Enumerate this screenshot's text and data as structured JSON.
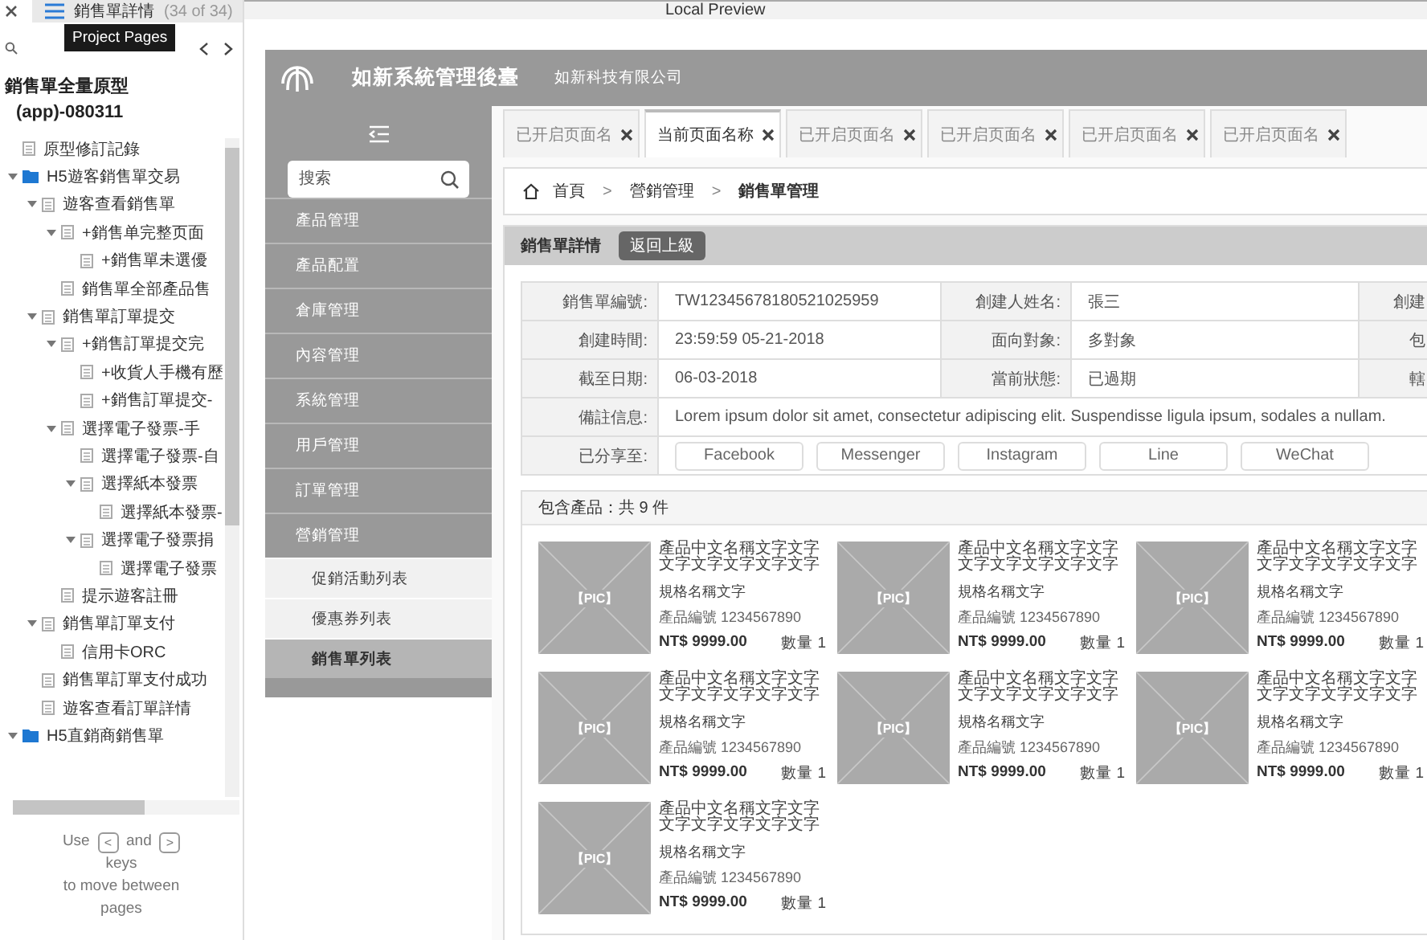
{
  "pages_panel": {
    "current_page": "銷售單詳情",
    "page_count": "(34 of 34)",
    "tooltip": "Project Pages",
    "project_title": "銷售單全量原型",
    "project_subtitle": "(app)-080311",
    "tree": [
      {
        "label": "原型修訂記錄",
        "kind": "page"
      },
      {
        "label": "H5遊客銷售單交易",
        "kind": "folder",
        "expanded": true,
        "children": [
          {
            "label": "遊客查看銷售單",
            "kind": "page",
            "expanded": true,
            "children": [
              {
                "label": "+銷售单完整页面",
                "kind": "page",
                "expanded": true,
                "children": [
                  {
                    "label": "+銷售單未選優",
                    "kind": "page"
                  }
                ]
              },
              {
                "label": "銷售單全部產品售",
                "kind": "page"
              }
            ]
          },
          {
            "label": "銷售單訂單提交",
            "kind": "page",
            "expanded": true,
            "children": [
              {
                "label": "+銷售訂單提交完",
                "kind": "page",
                "expanded": true,
                "children": [
                  {
                    "label": "+收貨人手機有歷",
                    "kind": "page"
                  },
                  {
                    "label": "+銷售訂單提交-",
                    "kind": "page"
                  }
                ]
              },
              {
                "label": "選擇電子發票-手",
                "kind": "page",
                "expanded": true,
                "children": [
                  {
                    "label": "選擇電子發票-自",
                    "kind": "page"
                  },
                  {
                    "label": "選擇紙本發票",
                    "kind": "page",
                    "expanded": true,
                    "children": [
                      {
                        "label": "選擇紙本發票-",
                        "kind": "page"
                      }
                    ]
                  },
                  {
                    "label": "選擇電子發票捐",
                    "kind": "page",
                    "expanded": true,
                    "children": [
                      {
                        "label": "選擇電子發票",
                        "kind": "page"
                      }
                    ]
                  }
                ]
              },
              {
                "label": "提示遊客註冊",
                "kind": "page"
              }
            ]
          },
          {
            "label": "銷售單訂單支付",
            "kind": "page",
            "expanded": true,
            "children": [
              {
                "label": "信用卡ORC",
                "kind": "page"
              }
            ]
          },
          {
            "label": "銷售單訂單支付成功",
            "kind": "page"
          },
          {
            "label": "遊客查看訂單詳情",
            "kind": "page"
          }
        ]
      },
      {
        "label": "H5直銷商銷售單",
        "kind": "folder",
        "expanded": true
      }
    ],
    "help": {
      "use": "Use",
      "prev_key": "<",
      "and": "and",
      "next_key": ">",
      "keys": "keys",
      "rest": "to move between pages"
    }
  },
  "preview": {
    "title": "Local Preview"
  },
  "app": {
    "title": "如新系統管理後臺",
    "company": "如新科技有限公司",
    "sidebar": {
      "search_placeholder": "搜索",
      "menu": [
        {
          "label": "產品管理"
        },
        {
          "label": "產品配置"
        },
        {
          "label": "倉庫管理"
        },
        {
          "label": "內容管理"
        },
        {
          "label": "系統管理"
        },
        {
          "label": "用戶管理"
        },
        {
          "label": "訂單管理"
        },
        {
          "label": "營銷管理",
          "children": [
            {
              "label": "促銷活動列表",
              "selected": false
            },
            {
              "label": "優惠券列表",
              "selected": false
            },
            {
              "label": "銷售單列表",
              "selected": true
            }
          ]
        }
      ]
    },
    "tabs": [
      {
        "label": "已开启页面名",
        "selected": false
      },
      {
        "label": "当前页面名称",
        "selected": true
      },
      {
        "label": "已开启页面名",
        "selected": false
      },
      {
        "label": "已开启页面名",
        "selected": false
      },
      {
        "label": "已开启页面名",
        "selected": false
      },
      {
        "label": "已开启页面名",
        "selected": false
      }
    ],
    "breadcrumb": {
      "separator": ">",
      "items": [
        "首頁",
        "營銷管理",
        "銷售單管理"
      ]
    },
    "detail": {
      "title": "銷售單詳情",
      "back_button": "返回上級",
      "rows": [
        {
          "cells": [
            "銷售單編號:",
            "TW12345678180521025959",
            "創建人姓名:",
            "張三",
            "創建"
          ]
        },
        {
          "cells": [
            "創建時間:",
            "23:59:59 05-21-2018",
            "面向對象:",
            "多對象",
            "包"
          ]
        },
        {
          "cells": [
            "截至日期:",
            "06-03-2018",
            "當前狀態:",
            "已過期",
            "轄"
          ]
        }
      ],
      "note": {
        "label": "備註信息:",
        "value": "Lorem ipsum dolor sit amet, consectetur adipiscing elit. Suspendisse ligula ipsum, sodales a nullam."
      },
      "share": {
        "label": "已分享至:",
        "targets": [
          "Facebook",
          "Messenger",
          "Instagram",
          "Line",
          "WeChat"
        ]
      }
    },
    "products": {
      "title": "包含產品：共 9 件",
      "items": [
        {
          "image": "【PIC】",
          "name": "產品中文名稱文字文字文字文字文字文字文字",
          "spec": "規格名稱文字",
          "code": "產品編號 1234567890",
          "price": "NT$ 9999.00",
          "qty": "數量 1"
        },
        {
          "image": "【PIC】",
          "name": "產品中文名稱文字文字文字文字文字文字文字",
          "spec": "規格名稱文字",
          "code": "產品編號 1234567890",
          "price": "NT$ 9999.00",
          "qty": "數量 1"
        },
        {
          "image": "【PIC】",
          "name": "產品中文名稱文字文字文字文字文字文字文字",
          "spec": "規格名稱文字",
          "code": "產品編號 1234567890",
          "price": "NT$ 9999.00",
          "qty": "數量 1"
        },
        {
          "image": "【PIC】",
          "name": "產品中文名稱文字文字文字文字文字文字文字",
          "spec": "規格名稱文字",
          "code": "產品編號 1234567890",
          "price": "NT$ 9999.00",
          "qty": "數量 1"
        },
        {
          "image": "【PIC】",
          "name": "產品中文名稱文字文字文字文字文字文字文字",
          "spec": "規格名稱文字",
          "code": "產品編號 1234567890",
          "price": "NT$ 9999.00",
          "qty": "數量 1"
        },
        {
          "image": "【PIC】",
          "name": "產品中文名稱文字文字文字文字文字文字文字",
          "spec": "規格名稱文字",
          "code": "產品編號 1234567890",
          "price": "NT$ 9999.00",
          "qty": "數量 1"
        },
        {
          "image": "【PIC】",
          "name": "產品中文名稱文字文字文字文字文字文字文字",
          "spec": "規格名稱文字",
          "code": "產品編號 1234567890",
          "price": "NT$ 9999.00",
          "qty": "數量 1"
        }
      ]
    }
  }
}
